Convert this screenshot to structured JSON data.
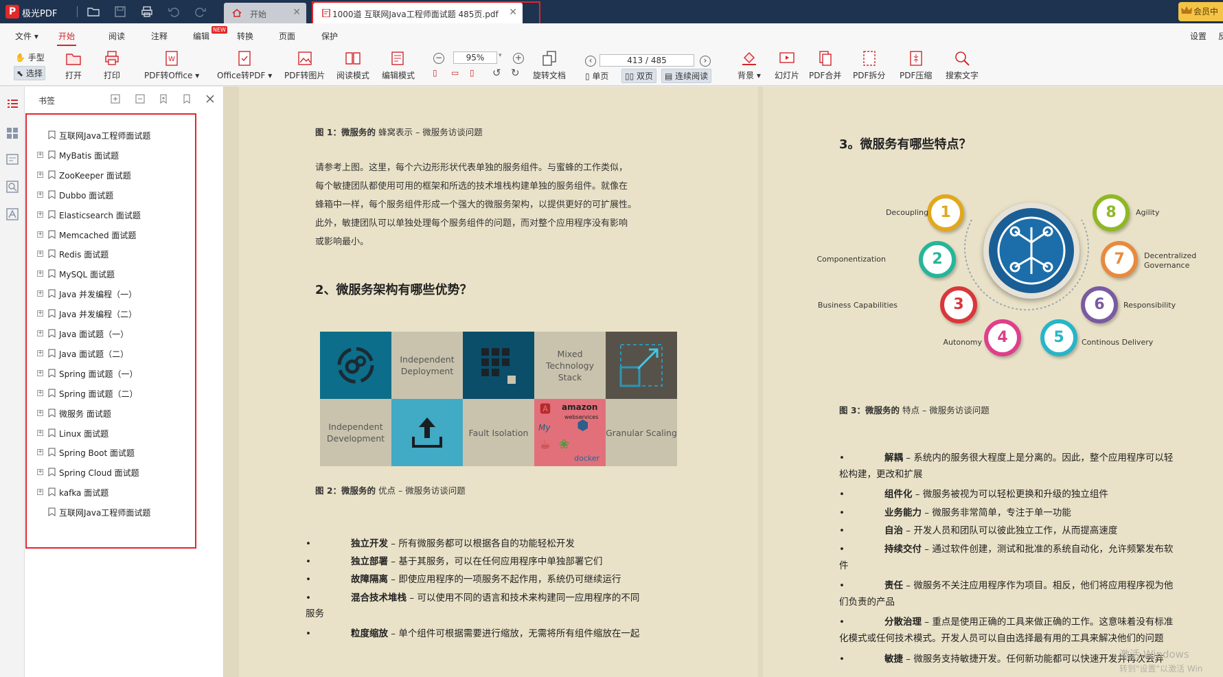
{
  "app": {
    "name": "极光PDF",
    "vip_label": "会员中"
  },
  "tabs": [
    {
      "label": "开始"
    },
    {
      "label": "1000道 互联网Java工程师面试题 485页.pdf"
    }
  ],
  "menu": [
    "文件",
    "开始",
    "阅读",
    "注释",
    "编辑",
    "转换",
    "页面",
    "保护"
  ],
  "menu_new_badge": "NEW",
  "menu_right": "设置",
  "menu_right2": "反",
  "toolbar": {
    "hand": "手型",
    "select": "选择",
    "open": "打开",
    "print": "打印",
    "pdf2office": "PDF转Office",
    "office2pdf": "Office转PDF",
    "pdf2img": "PDF转图片",
    "read_mode": "阅读模式",
    "edit_mode": "编辑模式",
    "zoom": "95%",
    "rotate_doc": "旋转文档",
    "page_input": "413 / 485",
    "single": "单页",
    "double": "双页",
    "continuous": "连续阅读",
    "background": "背景",
    "slideshow": "幻灯片",
    "merge": "PDF合并",
    "split": "PDF拆分",
    "compress": "PDF压缩",
    "search": "搜索文字"
  },
  "sidebar": {
    "title": "书签",
    "items": [
      {
        "label": "互联网Java工程师面试题",
        "expandable": false
      },
      {
        "label": "MyBatis 面试题",
        "expandable": true
      },
      {
        "label": "ZooKeeper 面试题",
        "expandable": true
      },
      {
        "label": "Dubbo 面试题",
        "expandable": true
      },
      {
        "label": "Elasticsearch 面试题",
        "expandable": true
      },
      {
        "label": "Memcached 面试题",
        "expandable": true
      },
      {
        "label": "Redis 面试题",
        "expandable": true
      },
      {
        "label": "MySQL 面试题",
        "expandable": true
      },
      {
        "label": "Java 并发编程（一）",
        "expandable": true
      },
      {
        "label": "Java 并发编程（二）",
        "expandable": true
      },
      {
        "label": "Java 面试题（一）",
        "expandable": true
      },
      {
        "label": "Java 面试题（二）",
        "expandable": true
      },
      {
        "label": "Spring 面试题（一）",
        "expandable": true
      },
      {
        "label": "Spring 面试题（二）",
        "expandable": true
      },
      {
        "label": "微服务 面试题",
        "expandable": true
      },
      {
        "label": "Linux 面试题",
        "expandable": true
      },
      {
        "label": "Spring Boot 面试题",
        "expandable": true
      },
      {
        "label": "Spring Cloud 面试题",
        "expandable": true
      },
      {
        "label": "kafka 面试题",
        "expandable": true
      },
      {
        "label": "互联网Java工程师面试题",
        "expandable": false
      }
    ]
  },
  "page1": {
    "fig1_caption_bold": "图 1：微服务的",
    "fig1_caption": "蜂窝表示 – 微服务访谈问题",
    "para1": [
      "请参考上图。这里，每个六边形形状代表单独的服务组件。与蜜蜂的工作类似，",
      "每个敏捷团队都使用可用的框架和所选的技术堆栈构建单独的服务组件。就像在",
      "蜂箱中一样，每个服务组件形成一个强大的微服务架构，以提供更好的可扩展性。",
      "此外，敏捷团队可以单独处理每个服务组件的问题，而对整个应用程序没有影响",
      "或影响最小。"
    ],
    "heading2": "2、微服务架构有哪些优势？",
    "fig2_cells": [
      "Independent Deployment",
      "Mixed Technology Stack",
      "Independent Development",
      "Fault Isolation",
      "Granular Scaling"
    ],
    "fig2_logos": [
      "amazon",
      "webservices",
      "My",
      "docker"
    ],
    "fig2_caption_bold": "图 2：微服务的",
    "fig2_caption": "优点 – 微服务访谈问题",
    "bullets": [
      {
        "b": "独立开发",
        "t": " – 所有微服务都可以根据各自的功能轻松开发"
      },
      {
        "b": "独立部署",
        "t": " – 基于其服务，可以在任何应用程序中单独部署它们"
      },
      {
        "b": "故障隔离",
        "t": " – 即使应用程序的一项服务不起作用，系统仍可继续运行"
      },
      {
        "b": "混合技术堆栈",
        "t": " – 可以使用不同的语言和技术来构建同一应用程序的不同",
        "cont": "服务"
      },
      {
        "b": "粒度缩放",
        "t": " – 单个组件可根据需要进行缩放，无需将所有组件缩放在一起"
      }
    ]
  },
  "page2": {
    "heading3": "3。微服务有哪些特点？",
    "fig3": [
      {
        "n": "1",
        "label": "Decoupling",
        "color": "#e0a81e"
      },
      {
        "n": "2",
        "label": "Componentization",
        "color": "#26b59a"
      },
      {
        "n": "3",
        "label": "Business Capabilities",
        "color": "#d9373a"
      },
      {
        "n": "4",
        "label": "Autonomy",
        "color": "#de3f8a"
      },
      {
        "n": "5",
        "label": "Continous Delivery",
        "color": "#27b5c8"
      },
      {
        "n": "6",
        "label": "Responsibility",
        "color": "#7a5aa0"
      },
      {
        "n": "7",
        "label": "Decentralized Governance",
        "color": "#e88a3d"
      },
      {
        "n": "8",
        "label": "Agility",
        "color": "#8fb824"
      }
    ],
    "fig3_caption_bold": "图 3：微服务的",
    "fig3_caption": "特点 – 微服务访谈问题",
    "bullets": [
      {
        "b": "解耦",
        "t": " – 系统内的服务很大程度上是分离的。因此，整个应用程序可以轻",
        "cont": "松构建，更改和扩展"
      },
      {
        "b": "组件化",
        "t": " – 微服务被视为可以轻松更换和升级的独立组件"
      },
      {
        "b": "业务能力",
        "t": " – 微服务非常简单，专注于单一功能"
      },
      {
        "b": "自治",
        "t": " – 开发人员和团队可以彼此独立工作，从而提高速度"
      },
      {
        "b": "持续交付",
        "t": " – 通过软件创建，测试和批准的系统自动化，允许频繁发布软",
        "cont": "件"
      },
      {
        "b": "责任",
        "t": " – 微服务不关注应用程序作为项目。相反，他们将应用程序视为他",
        "cont": "们负责的产品"
      },
      {
        "b": "分散治理",
        "t": " – 重点是使用正确的工具来做正确的工作。这意味着没有标准",
        "cont": "化模式或任何技术模式。开发人员可以自由选择最有用的工具来解决他们的问题"
      },
      {
        "b": "敏捷",
        "t": " – 微服务支持敏捷开发。任何新功能都可以快速开发并再次丢弃"
      }
    ],
    "watermark1": "激活 Windows",
    "watermark2": "转到\"设置\"以激活 Win"
  }
}
